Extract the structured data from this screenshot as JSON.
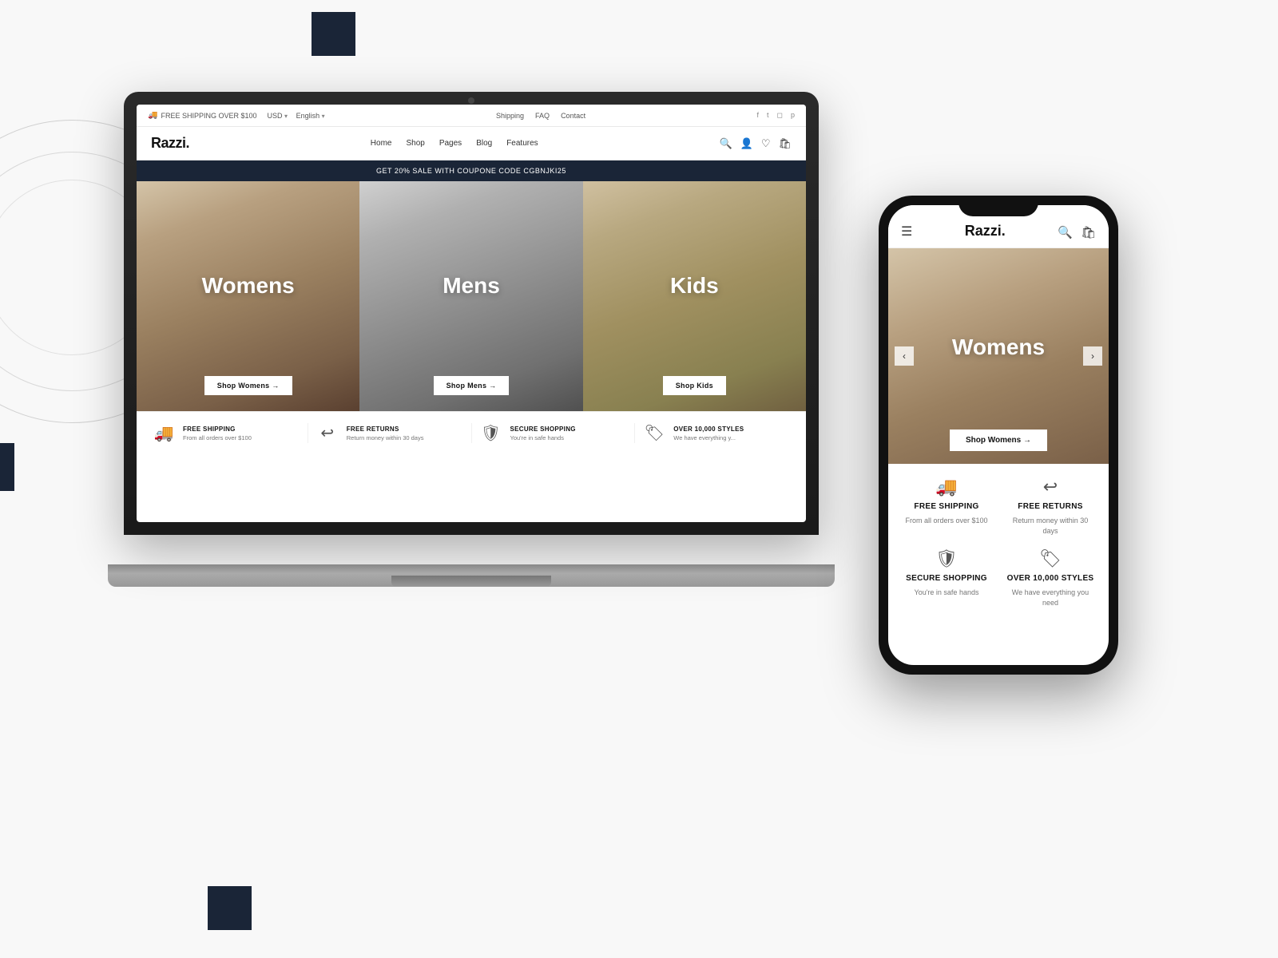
{
  "background": {
    "color": "#f8f8f8"
  },
  "laptop": {
    "screen": {
      "topbar": {
        "shipping_label": "FREE SHIPPING OVER $100",
        "currency": "USD",
        "language": "English",
        "nav_links": [
          "Shipping",
          "FAQ",
          "Contact"
        ],
        "social_icons": [
          "f",
          "t",
          "ig",
          "p"
        ]
      },
      "navbar": {
        "logo": "Razzi.",
        "nav_links": [
          "Home",
          "Shop",
          "Pages",
          "Blog",
          "Features"
        ],
        "icons": [
          "search",
          "user",
          "heart",
          "cart"
        ]
      },
      "promo_bar": "GET 20% SALE WITH COUPONE CODE CGBNJKI25",
      "hero": {
        "panels": [
          {
            "label": "Womens",
            "button": "Shop Womens →"
          },
          {
            "label": "Mens",
            "button": "Shop Mens →"
          },
          {
            "label": "Kids",
            "button": "Shop Kids"
          }
        ]
      },
      "features": [
        {
          "icon": "truck",
          "title": "FREE SHIPPING",
          "desc": "From all orders over $100"
        },
        {
          "icon": "refresh",
          "title": "FREE RETURNS",
          "desc": "Return money within 30 days"
        },
        {
          "icon": "shield",
          "title": "SECURE SHOPPING",
          "desc": "You're in safe hands"
        },
        {
          "icon": "tag",
          "title": "OVER 10,000 STYLES",
          "desc": "We have everything you"
        }
      ]
    }
  },
  "phone": {
    "screen": {
      "navbar": {
        "logo": "Razzi.",
        "icons": [
          "search",
          "cart"
        ]
      },
      "hero": {
        "label": "Womens",
        "button": "Shop Womens →"
      },
      "features": [
        {
          "icon": "truck",
          "title": "FREE SHIPPING",
          "desc": "From all orders over $100"
        },
        {
          "icon": "refresh",
          "title": "FREE RETURNS",
          "desc": "Return money within 30 days"
        },
        {
          "icon": "shield",
          "title": "SECURE SHOPPING",
          "desc": "You're in safe hands"
        },
        {
          "icon": "tag",
          "title": "OVER 10,000 STYLES",
          "desc": "We have everything you need"
        }
      ]
    }
  }
}
